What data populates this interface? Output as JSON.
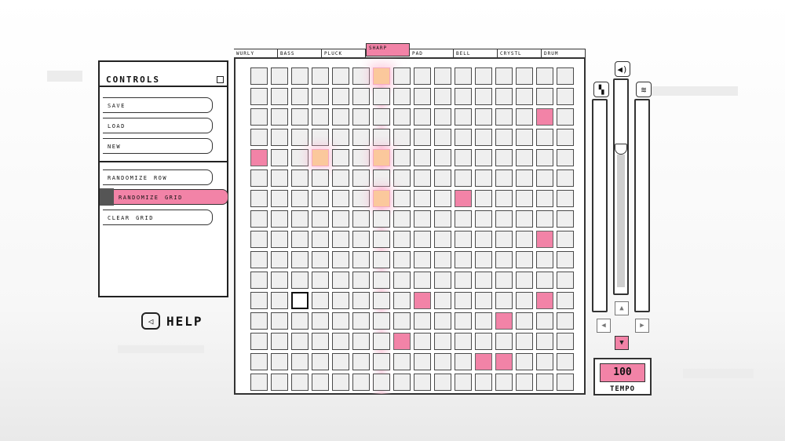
{
  "controls": {
    "title": "controls",
    "buttons": [
      "save",
      "load",
      "new",
      "randomize row",
      "randomize grid",
      "clear grid"
    ],
    "active_button": "randomize grid"
  },
  "help": {
    "label": "HELP"
  },
  "tabs": [
    "wurly",
    "bass",
    "pluck",
    "sharp",
    "pad",
    "bell",
    "crystl",
    "drum"
  ],
  "selected_tab": "sharp",
  "grid": {
    "columns": 16,
    "rows": 16,
    "active_cells": [
      [
        2,
        14
      ],
      [
        4,
        0
      ],
      [
        4,
        3
      ],
      [
        6,
        10
      ],
      [
        8,
        14
      ],
      [
        11,
        8
      ],
      [
        11,
        14
      ],
      [
        12,
        12
      ],
      [
        13,
        7
      ],
      [
        14,
        11
      ],
      [
        14,
        12
      ]
    ],
    "playing_column": 6,
    "playing_cells": [
      [
        0,
        6
      ],
      [
        4,
        6
      ],
      [
        6,
        6
      ],
      [
        4,
        3
      ]
    ],
    "cursor": [
      11,
      2
    ]
  },
  "tempo": {
    "value": "100",
    "label": "TEMPO"
  },
  "volume_level": 0.85,
  "icons": {
    "help": "left-arrow-icon",
    "volume": "speaker-icon",
    "layout": "panel-icon",
    "sound": "wave-icon"
  },
  "colors": {
    "accent": "#f283a7",
    "playhead": "#fbc89c"
  }
}
